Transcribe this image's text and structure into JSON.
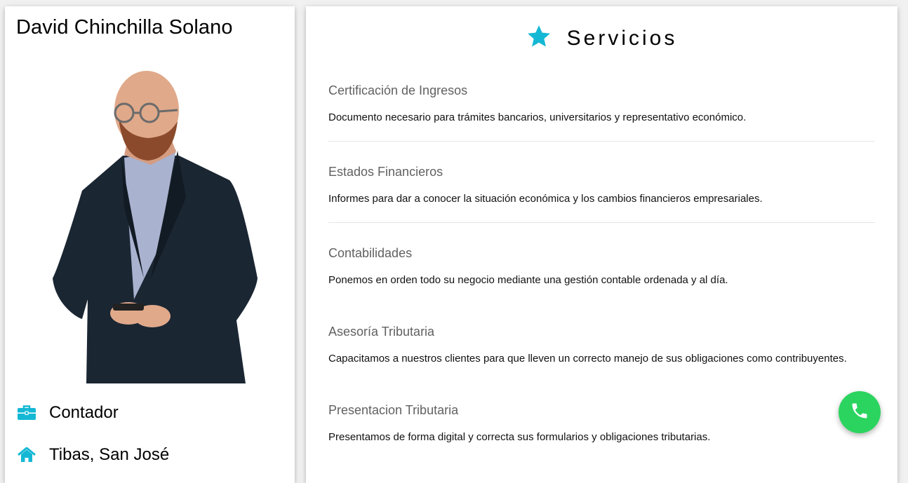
{
  "profile": {
    "name": "David Chinchilla Solano",
    "portrait_icon": "person-portrait",
    "occupation": "Contador",
    "occupation_icon": "briefcase-icon",
    "location": "Tibas, San José",
    "location_icon": "home-icon"
  },
  "services": {
    "title": "Servicios",
    "title_icon": "star-icon",
    "items": [
      {
        "name": "Certificación de Ingresos",
        "description": "Documento necesario para trámites bancarios, universitarios y representativo económico."
      },
      {
        "name": "Estados Financieros",
        "description": "Informes para dar a conocer la situación económica y los cambios financieros empresariales."
      },
      {
        "name": "Contabilidades",
        "description": "Ponemos en orden todo su negocio mediante una gestión contable ordenada y al día."
      },
      {
        "name": "Asesoría Tributaria",
        "description": "Capacitamos a nuestros clientes para que lleven un correcto manejo de sus obligaciones como contribuyentes."
      },
      {
        "name": "Presentacion Tributaria",
        "description": "Presentamos de forma digital y correcta sus formularios y obligaciones tributarias."
      }
    ]
  },
  "call_button": {
    "icon": "phone-icon"
  },
  "colors": {
    "accent": "#15b8d4",
    "call_green": "#2bd45f",
    "service_heading": "#616161",
    "page_background": "#f1f1f1"
  }
}
